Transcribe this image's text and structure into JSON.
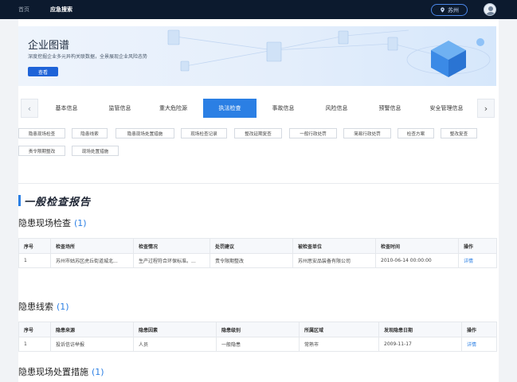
{
  "topbar": {
    "home_label": "首页",
    "search_label": "应急搜索",
    "city": "苏州"
  },
  "banner": {
    "title": "企业图谱",
    "subtitle": "深度挖掘企业多元异构关联数据，全景展现企业风险态势",
    "button_label": "查看"
  },
  "tabs": [
    "基本信息",
    "监管信息",
    "重大危险源",
    "执法检查",
    "事故信息",
    "风险信息",
    "预警信息",
    "安全管理信息"
  ],
  "active_tab": "执法检查",
  "subtags": [
    "隐患现场检查",
    "隐患线索",
    "隐患现场处置措施",
    "现场检查记录",
    "整改延期复查",
    "一般行政处罚",
    "简易行政处罚",
    "检查方案",
    "整改复查",
    "责令限期整改",
    "现场处置措施"
  ],
  "report_title": "一般检查报告",
  "sections": {
    "inspection": {
      "title": "隐患现场检查",
      "count": "(1)",
      "columns": [
        "序号",
        "检查场所",
        "检查情况",
        "处罚建议",
        "被检查单位",
        "检查时间",
        "操作"
      ],
      "rows": [
        [
          "1",
          "苏州市姑苏区虎丘街道城北...",
          "生产过程符合环保标准。...",
          "责令限期整改",
          "苏州思安品装备有限公司",
          "2010-06-14 00:00:00",
          "详情"
        ]
      ]
    },
    "clues": {
      "title": "隐患线索",
      "count": "(1)",
      "columns": [
        "序号",
        "隐患来源",
        "隐患因素",
        "隐患级别",
        "所属区域",
        "发现隐患日期",
        "操作"
      ],
      "rows": [
        [
          "1",
          "投诉信访举报",
          "人员",
          "一般隐患",
          "常熟市",
          "2009-11-17",
          "详情"
        ]
      ]
    },
    "measures": {
      "title": "隐患现场处置措施",
      "count": "(1)"
    }
  }
}
